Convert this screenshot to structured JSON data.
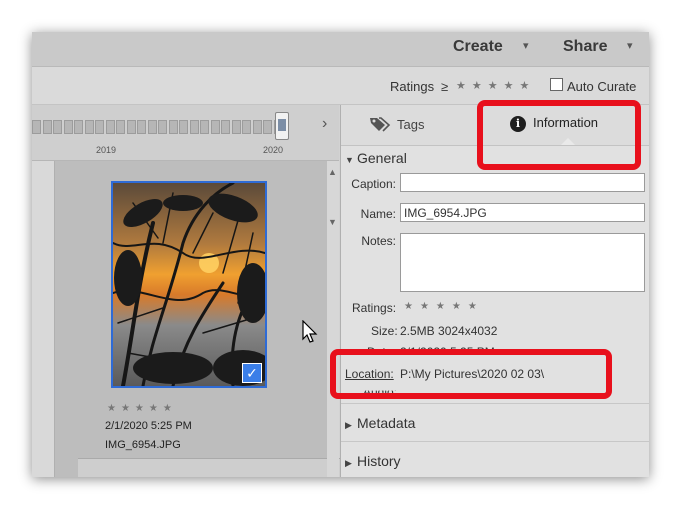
{
  "header": {
    "create_label": "Create",
    "share_label": "Share",
    "caret": "▾"
  },
  "ratings_bar": {
    "label": "Ratings",
    "operator": "≥",
    "stars": "★★★★★",
    "auto_curate_label": "Auto Curate",
    "auto_curate_checked": false
  },
  "timeline": {
    "years": [
      "2019",
      "2020"
    ]
  },
  "photo": {
    "stars": "★★★★★",
    "date": "2/1/2020 5:25 PM",
    "filename": "IMG_6954.JPG",
    "selected": true,
    "check": "✓"
  },
  "panel": {
    "tabs": [
      {
        "label": "Tags",
        "icon": "tag-icon",
        "active": false
      },
      {
        "label": "Information",
        "icon": "info-icon",
        "active": true
      }
    ],
    "general": {
      "title": "General",
      "caption_label": "Caption:",
      "caption_value": "",
      "name_label": "Name:",
      "name_value": "IMG_6954.JPG",
      "notes_label": "Notes:",
      "notes_value": "",
      "ratings_label": "Ratings:",
      "ratings_stars": "★★★★★",
      "size_label": "Size:",
      "size_value": "2.5MB  3024x4032",
      "date_label": "Date:",
      "date_value": "2/1/2020 5:25 PM",
      "location_label": "Location:",
      "location_value": "P:\\My Pictures\\2020 02 03\\",
      "audio_label": "Audio:"
    },
    "metadata_title": "Metadata",
    "history_title": "History"
  },
  "colors": {
    "highlight": "#e8101c",
    "selection": "#2e6bd6"
  }
}
